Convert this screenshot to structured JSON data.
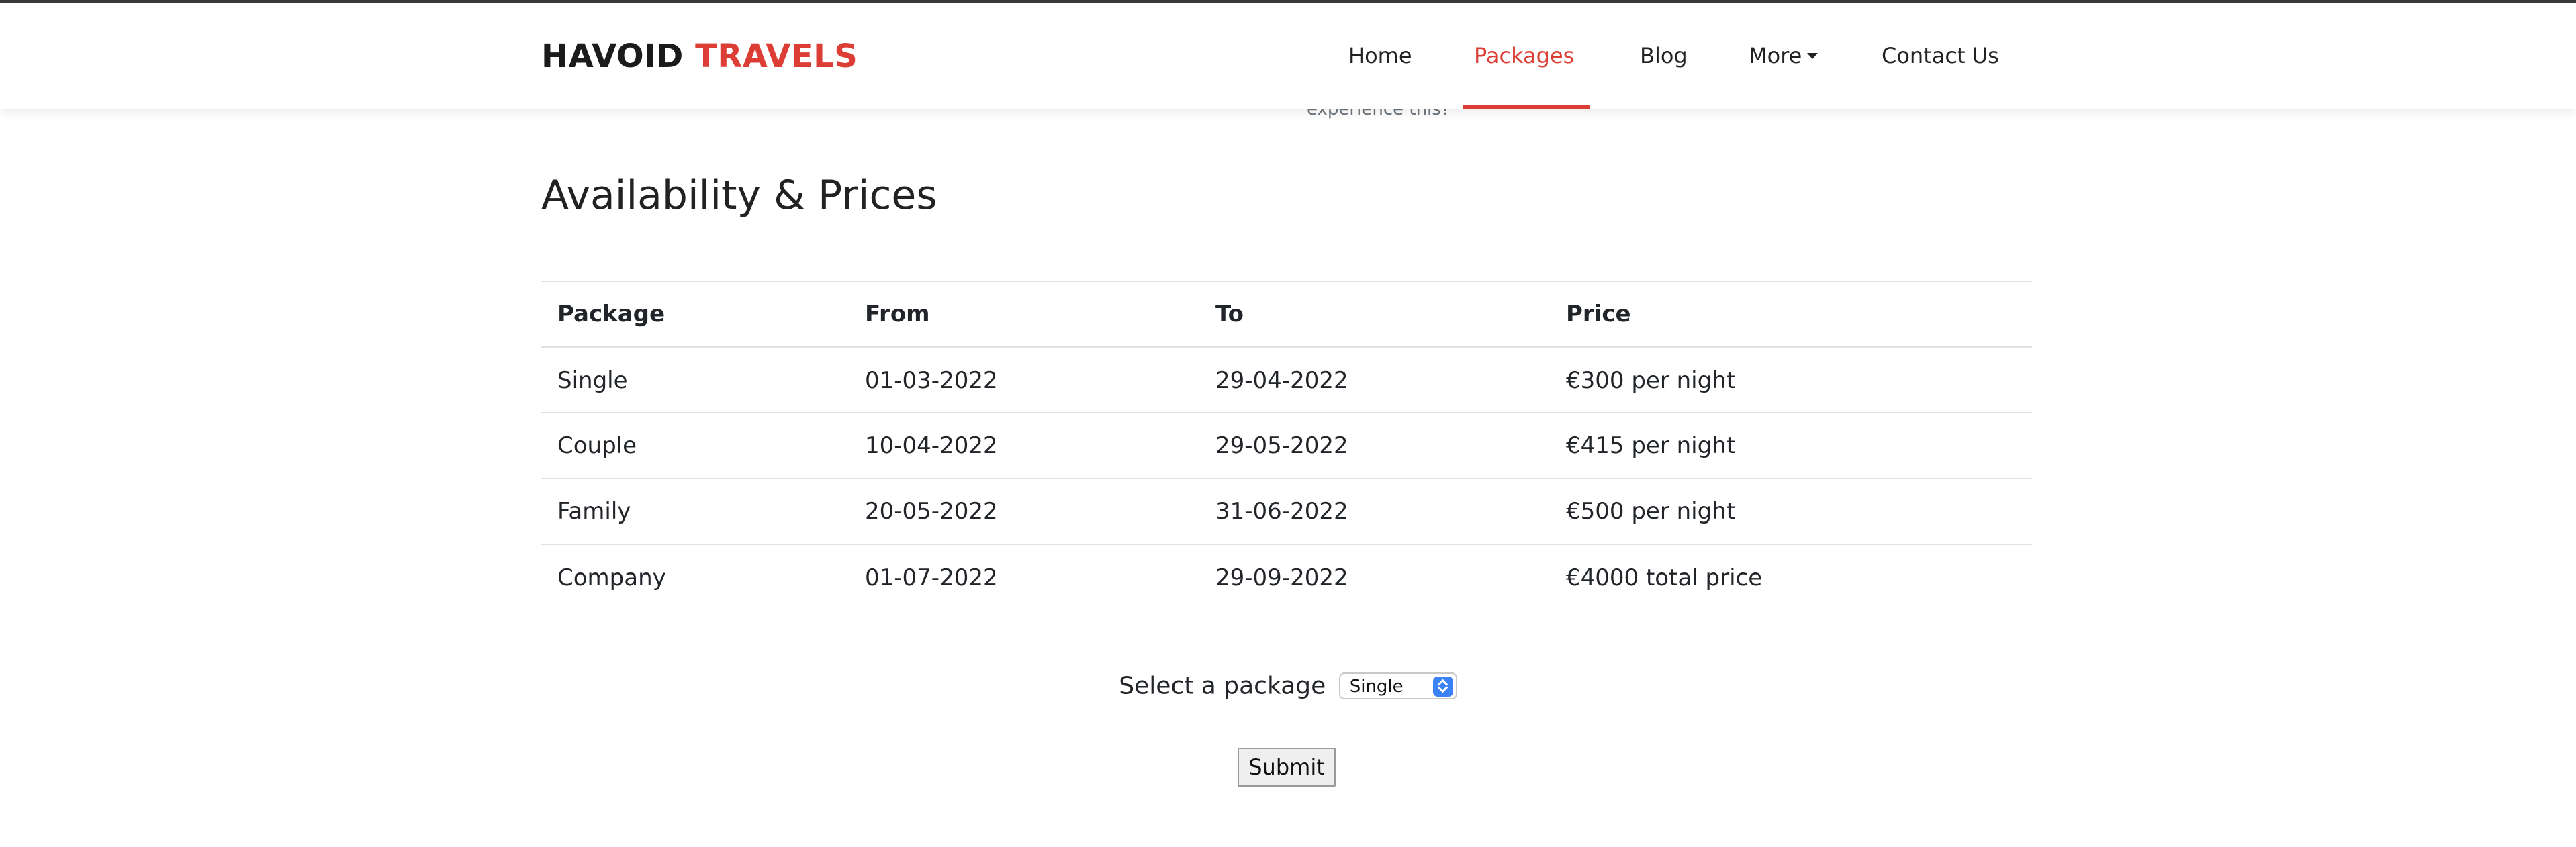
{
  "nav": {
    "brand_primary": "HAVOID",
    "brand_accent": "TRAVELS",
    "items": [
      {
        "label": "Home"
      },
      {
        "label": "Packages",
        "active": true
      },
      {
        "label": "Blog"
      },
      {
        "label": "More",
        "has_dropdown": true
      },
      {
        "label": "Contact Us"
      }
    ],
    "accent_color": "#dc3e35"
  },
  "peek_text": "experience this?",
  "section_title": "Availability & Prices",
  "table": {
    "headers": [
      "Package",
      "From",
      "To",
      "Price"
    ],
    "rows": [
      [
        "Single",
        "01-03-2022",
        "29-04-2022",
        "€300 per night"
      ],
      [
        "Couple",
        "10-04-2022",
        "29-05-2022",
        "€415 per night"
      ],
      [
        "Family",
        "20-05-2022",
        "31-06-2022",
        "€500 per night"
      ],
      [
        "Company",
        "01-07-2022",
        "29-09-2022",
        "€4000 total price"
      ]
    ]
  },
  "form": {
    "select_label": "Select a package",
    "selected_value": "Single",
    "submit_label": "Submit"
  },
  "icons": {
    "dropdown_caret": "chevron-down-icon",
    "select_spinner": "select-updown-icon"
  }
}
